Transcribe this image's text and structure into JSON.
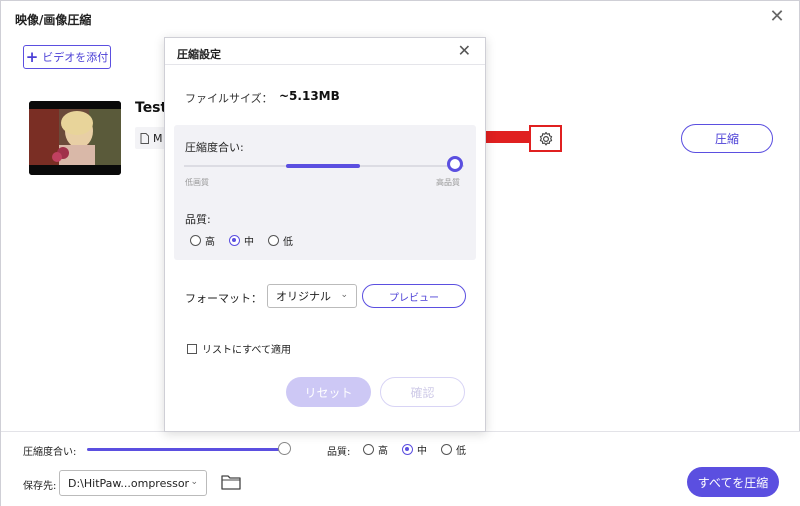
{
  "app": {
    "title": "映像/画像圧縮",
    "close_glyph": "✕"
  },
  "toolbar": {
    "add_label": "ビデオを添付"
  },
  "file": {
    "name": "Test_",
    "meta_prefix": "M"
  },
  "compress_button": "圧縮",
  "dialog": {
    "title": "圧縮設定",
    "close_glyph": "✕",
    "file_size_label": "ファイルサイズ：",
    "file_size_value": "~5.13MB",
    "compression_label": "圧縮度合い:",
    "compression_level": 1.0,
    "low_quality_label": "低画質",
    "high_quality_label": "高品質",
    "quality_label": "品質:",
    "quality_options": [
      "高",
      "中",
      "低"
    ],
    "quality_selected": "中",
    "format_label": "フォーマット：",
    "format_value": "オリジナル",
    "preview_label": "プレビュー",
    "apply_all_label": "リストにすべて適用",
    "reset_label": "リセット",
    "ok_label": "確認"
  },
  "footer": {
    "compression_label": "圧縮度合い:",
    "compression_level": 1.0,
    "quality_label": "品質:",
    "quality_options": [
      "高",
      "中",
      "低"
    ],
    "quality_selected": "中",
    "save_label": "保存先:",
    "save_path": "D:\\HitPaw...ompressor",
    "compress_all_label": "すべてを圧縮"
  },
  "colors": {
    "accent": "#5b4fe0",
    "highlight_red": "#e02020"
  }
}
